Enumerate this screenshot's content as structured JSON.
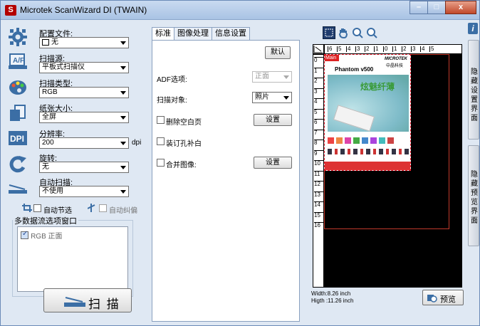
{
  "window": {
    "title": "Microtek ScanWizard DI (TWAIN)",
    "app_icon_letter": "S",
    "controls": [
      "–",
      "□",
      "x"
    ]
  },
  "left": {
    "config": {
      "label": "配置文件:",
      "value": "无"
    },
    "source": {
      "label": "扫描源:",
      "value": "平板式扫描仪"
    },
    "type": {
      "label": "扫描类型:",
      "value": "RGB"
    },
    "size": {
      "label": "纸张大小:",
      "value": "全屏"
    },
    "resolution": {
      "label": "分辨率:",
      "value": "200",
      "unit": "dpi"
    },
    "rotate": {
      "label": "旋转:",
      "value": "无"
    },
    "autoscan": {
      "label": "自动扫描:",
      "value": "不使用"
    },
    "autocrop_label": "自动节选",
    "autodeskew_label": "自动纠偏",
    "multistream": {
      "title": "多数据流选项窗口",
      "item": "RGB 正面"
    },
    "scan_button": "扫 描"
  },
  "middle": {
    "tabs": [
      "标准",
      "图像处理",
      "信息设置"
    ],
    "default_button": "默认",
    "adf_label": "ADF选项:",
    "adf_value": "正面",
    "object_label": "扫描对象:",
    "object_value": "照片",
    "blank_label": "删除空白页",
    "blank_settings": "设置",
    "hole_label": "装订孔补白",
    "merge_label": "合并图像:",
    "merge_settings": "设置"
  },
  "right": {
    "ruler_x": [
      "6",
      "5",
      "4",
      "3",
      "2",
      "1",
      "0",
      "1",
      "2",
      "3",
      "4",
      "5"
    ],
    "ruler_y": [
      "0",
      "1",
      "2",
      "3",
      "4",
      "5",
      "6",
      "7",
      "8",
      "9",
      "10",
      "11",
      "12",
      "13",
      "14",
      "15",
      "16"
    ],
    "main_tag": "Main",
    "width_text": "Width:8.26 inch",
    "height_text": "Higth :11.26 inch",
    "preview_button": "预览",
    "thumb_product": "Phantom v500",
    "thumb_brand": "MICROTEK",
    "thumb_brand_cn": "中晶科技",
    "thumb_slogan": "炫魅纤薄"
  },
  "sidebars": {
    "info_icon": "i",
    "hide_settings": "隐藏设置界面",
    "hide_preview": "隐藏预览界面"
  },
  "icons": {
    "config": "gear-icon",
    "source": "flatbed-scanner-icon",
    "type": "palette-icon",
    "size": "paper-size-icon",
    "resolution": "dpi-icon",
    "rotate": "rotate-icon",
    "autoscan": "auto-scan-icon",
    "crop": "crop-icon",
    "deskew": "deskew-icon"
  }
}
